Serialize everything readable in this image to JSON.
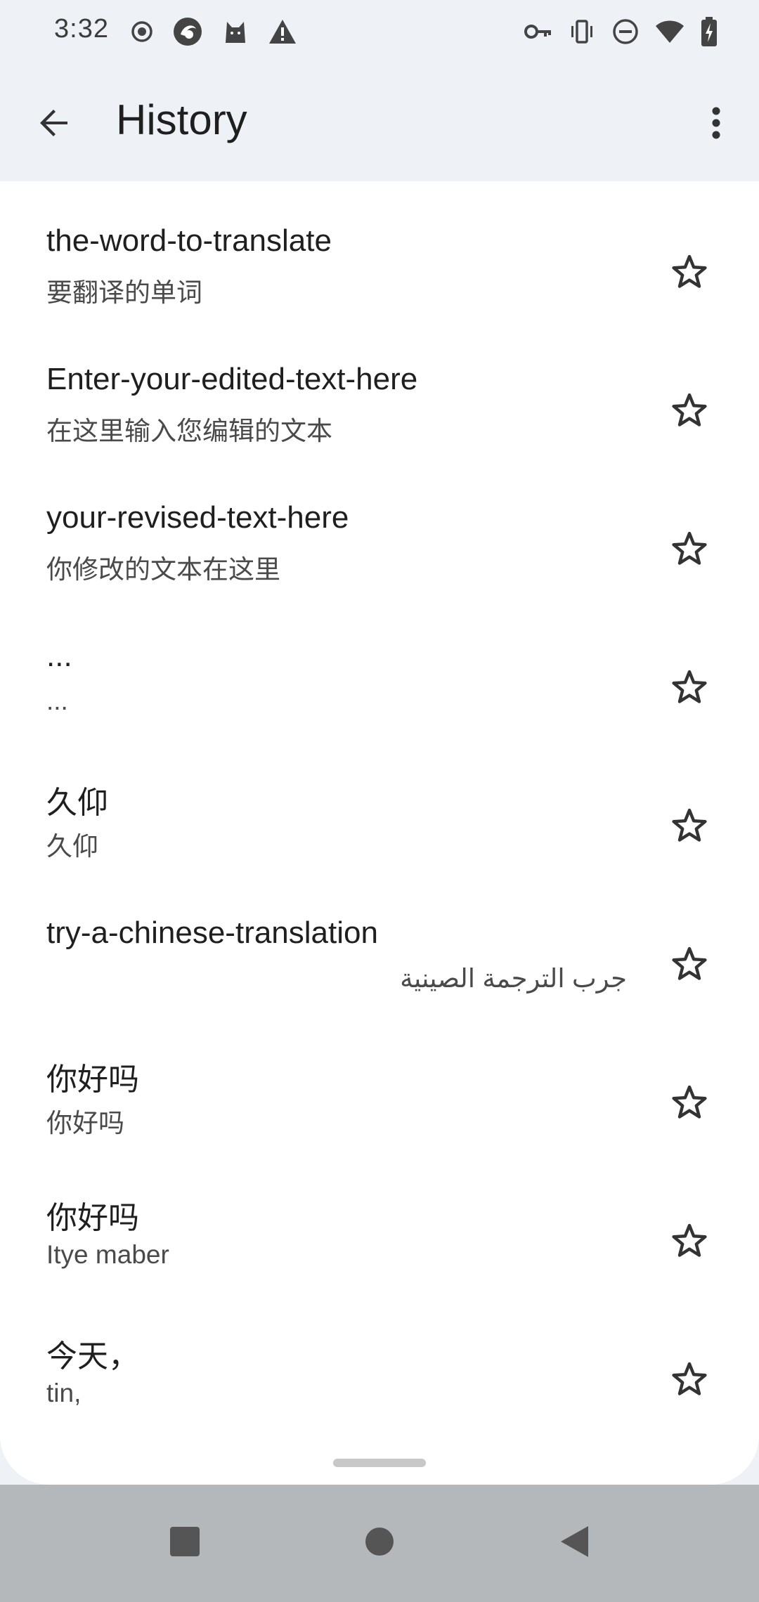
{
  "status_bar": {
    "time": "3:32",
    "left_icons": [
      "record-icon",
      "app-icon",
      "cat-icon",
      "warning-icon"
    ],
    "right_icons": [
      "key-icon",
      "vibrate-icon",
      "do-not-disturb-icon",
      "wifi-icon",
      "battery-charging-icon"
    ]
  },
  "app_bar": {
    "back_icon": "arrow-back-icon",
    "title": "History",
    "more_icon": "more-vert-icon"
  },
  "history": {
    "items": [
      {
        "primary": "the-word-to-translate",
        "secondary": "要翻译的单词",
        "starred": false
      },
      {
        "primary": "Enter-your-edited-text-here",
        "secondary": "在这里输入您编辑的文本",
        "starred": false
      },
      {
        "primary": "your-revised-text-here",
        "secondary": "你修改的文本在这里",
        "starred": false
      },
      {
        "primary": "...",
        "secondary": "...",
        "starred": false
      },
      {
        "primary": "久仰",
        "secondary": "久仰",
        "starred": false
      },
      {
        "primary": "try-a-chinese-translation",
        "secondary": "جرب الترجمة الصينية",
        "starred": false,
        "rtl": true
      },
      {
        "primary": "你好吗",
        "secondary": "你好吗",
        "starred": false
      },
      {
        "primary": "你好吗",
        "secondary": "Itye maber",
        "starred": false
      },
      {
        "primary": "今天，",
        "secondary": "tin,",
        "starred": false
      }
    ]
  },
  "nav_bar": {
    "buttons": [
      "recents-square-icon",
      "home-circle-icon",
      "back-triangle-icon"
    ]
  },
  "colors": {
    "background": "#eef2f7",
    "sheet": "#ffffff",
    "text_primary": "#1f1f1f",
    "text_secondary": "#4a4a4a",
    "nav_bar": "#b5b8bb"
  }
}
